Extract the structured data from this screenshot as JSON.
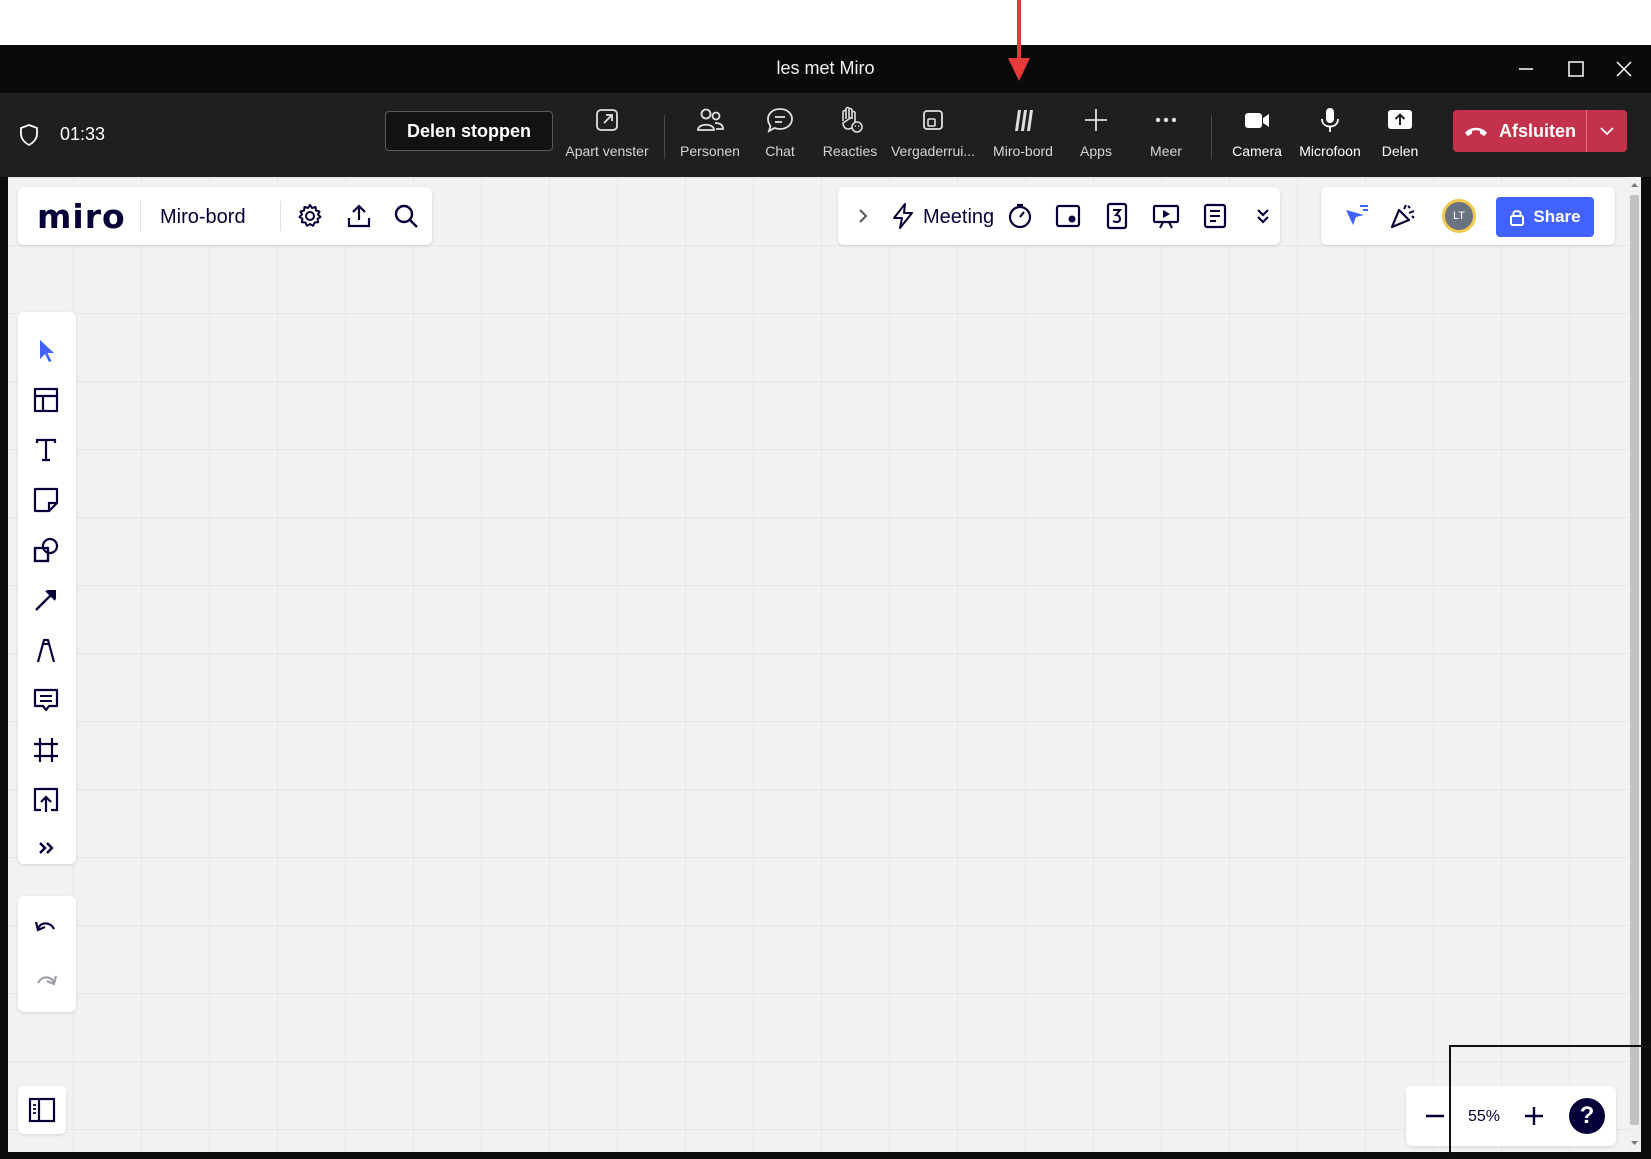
{
  "window": {
    "title": "les met Miro"
  },
  "meeting": {
    "timer": "01:33",
    "stop_sharing_label": "Delen stoppen",
    "tools": [
      {
        "label": "Apart venster",
        "icon": "popout-icon"
      },
      {
        "label": "Personen",
        "icon": "people-icon"
      },
      {
        "label": "Chat",
        "icon": "chat-icon"
      },
      {
        "label": "Reacties",
        "icon": "raise-hand-icon"
      },
      {
        "label": "Vergaderrui...",
        "icon": "rooms-icon"
      },
      {
        "label": "Miro-bord",
        "icon": "miro-icon"
      },
      {
        "label": "Apps",
        "icon": "plus-icon"
      },
      {
        "label": "Meer",
        "icon": "more-icon"
      },
      {
        "label": "Camera",
        "icon": "camera-icon"
      },
      {
        "label": "Microfoon",
        "icon": "microphone-icon"
      },
      {
        "label": "Delen",
        "icon": "share-screen-icon"
      }
    ],
    "leave_label": "Afsluiten",
    "leave_color": "#c4314b"
  },
  "miro": {
    "logo": "miro",
    "board_name": "Miro-bord",
    "meeting_label": "Meeting",
    "avatar_initials": "LT",
    "share_label": "Share",
    "share_color": "#4262ff",
    "accent_color": "#4262ff",
    "zoom": "55%",
    "help": "?",
    "toolbar": [
      "select",
      "templates",
      "text",
      "sticky-note",
      "shapes",
      "connection-line",
      "pen",
      "comment",
      "frame",
      "upload",
      "more-tools"
    ],
    "history": [
      "undo",
      "redo"
    ]
  }
}
